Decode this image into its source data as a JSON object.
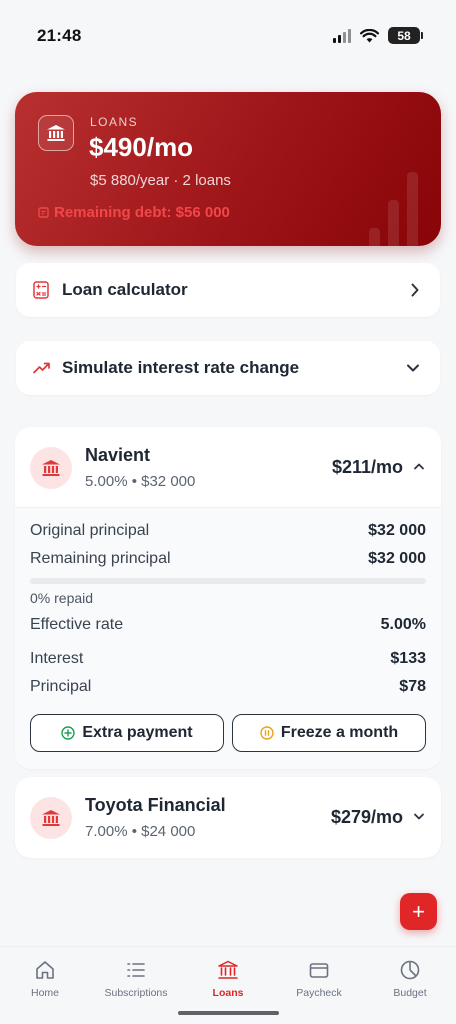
{
  "status": {
    "time": "21:48",
    "battery": "58"
  },
  "summary": {
    "label": "LOANS",
    "monthly": "$490/mo",
    "subtitle": "$5 880/year · 2 loans",
    "remaining": "Remaining debt: $56 000"
  },
  "rows": {
    "calculator": "Loan calculator",
    "simulate": "Simulate interest rate change"
  },
  "loans": [
    {
      "name": "Navient",
      "meta": "5.00% • $32 000",
      "monthly": "$211/mo",
      "expanded": true,
      "original_label": "Original principal",
      "original": "$32 000",
      "remaining_label": "Remaining principal",
      "remaining": "$32 000",
      "repaid_fraction": 0,
      "repaid_text": "0% repaid",
      "rate_label": "Effective rate",
      "rate": "5.00%",
      "interest_label": "Interest",
      "interest": "$133",
      "principal_label": "Principal",
      "principal": "$78",
      "extra_payment": "Extra payment",
      "freeze": "Freeze a month"
    },
    {
      "name": "Toyota Financial",
      "meta": "7.00% • $24 000",
      "monthly": "$279/mo",
      "expanded": false
    }
  ],
  "fab": "+",
  "nav": [
    {
      "label": "Home",
      "icon": "home-icon"
    },
    {
      "label": "Subscriptions",
      "icon": "list-icon"
    },
    {
      "label": "Loans",
      "icon": "bank-icon",
      "active": true
    },
    {
      "label": "Paycheck",
      "icon": "wallet-icon"
    },
    {
      "label": "Budget",
      "icon": "pie-chart-icon"
    }
  ],
  "colors": {
    "accent": "#e02626",
    "hero_start": "#b8302f",
    "hero_end": "#880407"
  }
}
